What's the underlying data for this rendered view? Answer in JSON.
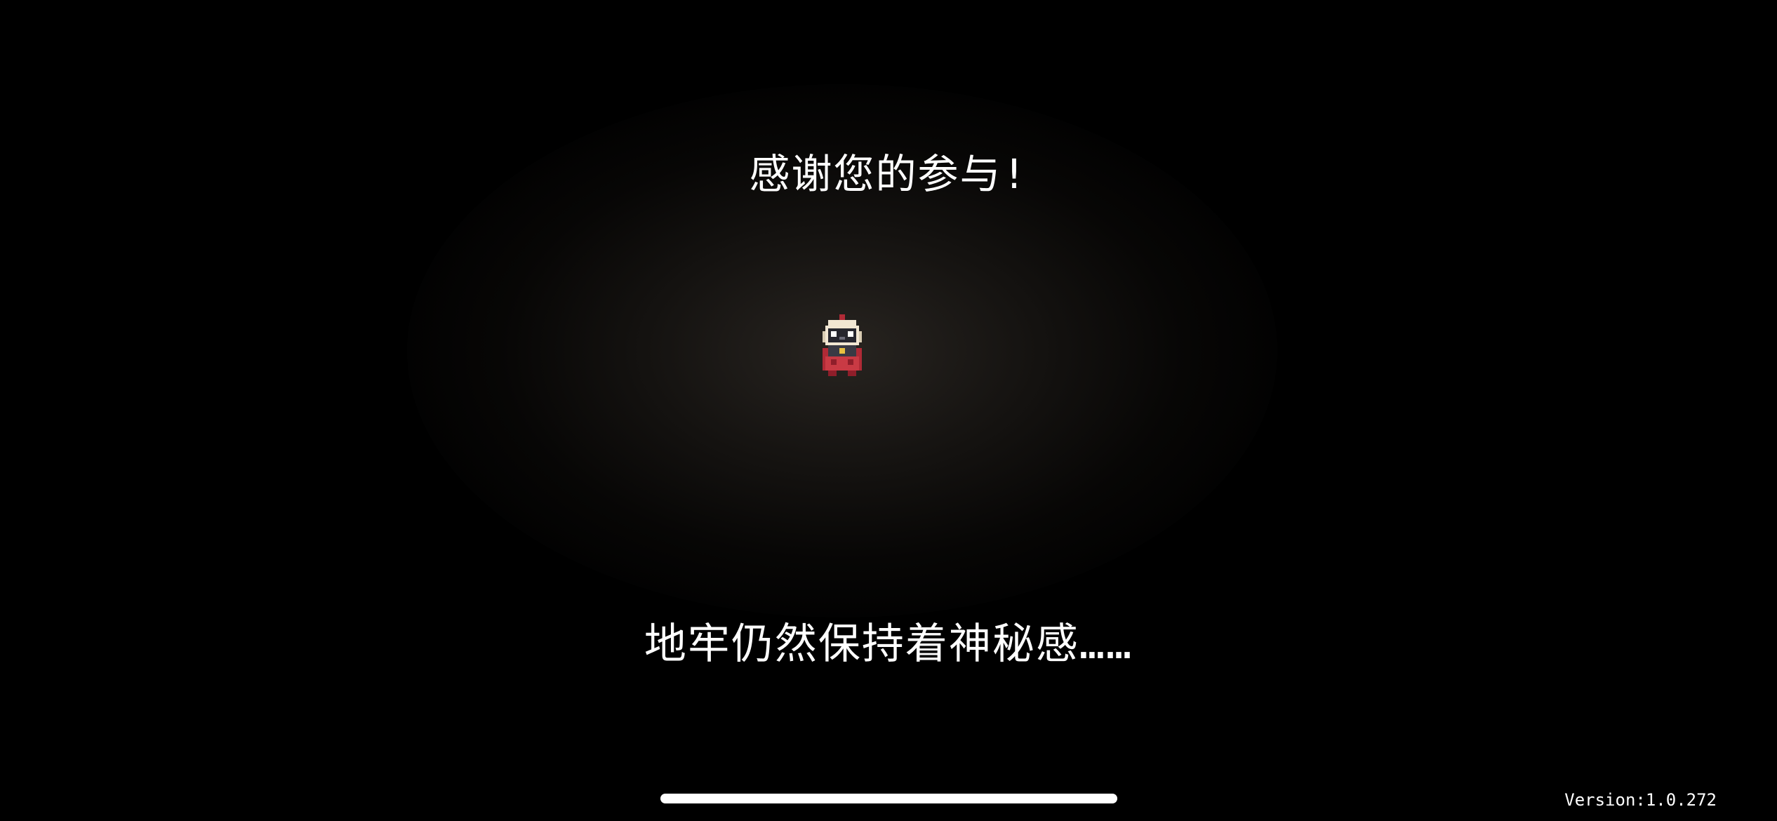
{
  "screen": {
    "thanks_text": "感谢您的参与!",
    "mystery_text": "地牢仍然保持着神秘感……",
    "version_text": "Version:1.0.272"
  },
  "character": {
    "icon": "pixel-knight-character-icon",
    "colors": {
      "helmet": "#f1e6d2",
      "visor": "#26262e",
      "cape": "#b02a36",
      "gem": "#e8c040"
    }
  },
  "colors": {
    "background": "#000000",
    "text": "#ffffff",
    "glow": "#2a2622"
  }
}
